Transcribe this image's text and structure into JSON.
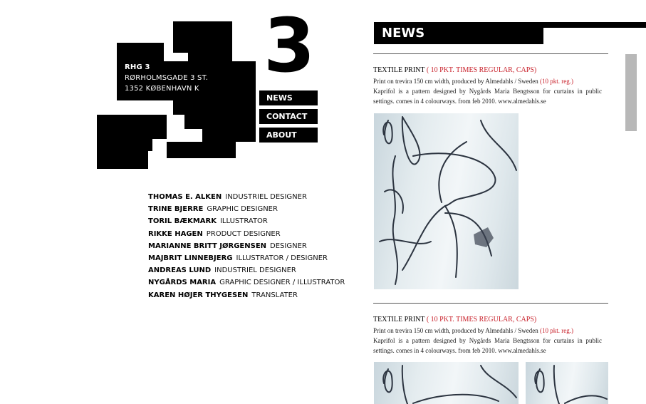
{
  "logo": {
    "number": "3",
    "name": "RHG 3",
    "address_line1": "RØRHOLMSGADE 3 ST.",
    "address_line2": "1352 KØBENHAVN K"
  },
  "nav": {
    "items": [
      {
        "label": "NEWS"
      },
      {
        "label": "CONTACT"
      },
      {
        "label": "ABOUT"
      }
    ]
  },
  "people": [
    {
      "name": "THOMAS E. ALKEN",
      "role": "INDUSTRIEL DESIGNER"
    },
    {
      "name": "TRINE BJERRE",
      "role": "GRAPHIC DESIGNER"
    },
    {
      "name": "TORIL BÆKMARK",
      "role": "ILLUSTRATOR"
    },
    {
      "name": "RIKKE HAGEN",
      "role": "PRODUCT DESIGNER"
    },
    {
      "name": "MARIANNE BRITT JØRGENSEN",
      "role": "DESIGNER"
    },
    {
      "name": "MAJBRIT LINNEBJERG",
      "role": "ILLUSTRATOR / DESIGNER"
    },
    {
      "name": "ANDREAS LUND",
      "role": "INDUSTRIEL DESIGNER"
    },
    {
      "name": "NYGÅRDS MARIA",
      "role": "GRAPHIC DESIGNER / ILLUSTRATOR"
    },
    {
      "name": "KAREN HØJER THYGESEN",
      "role": "TRANSLATER"
    }
  ],
  "news": {
    "heading": "NEWS",
    "articles": [
      {
        "title": "TEXTILE PRINT",
        "title_note": "( 10 PKT. TIMES REGULAR, CAPS)",
        "line1": "Print on trevira 150 cm width, produced by Almedahls / Sweden",
        "line1_note": "(10 pkt. reg.)",
        "body": "Kaprifol is a pattern designed by Nygårds Maria Bengtsson for curtains in public settings. comes in 4 colourways. from feb 2010. www.almedahls.se"
      },
      {
        "title": "TEXTILE PRINT",
        "title_note": "( 10 PKT. TIMES REGULAR, CAPS)",
        "line1": "Print on trevira 150 cm width, produced by Almedahls / Sweden",
        "line1_note": "(10 pkt. reg.)",
        "body": "Kaprifol is a pattern designed by Nygårds Maria Bengtsson for curtains in public settings. comes in 4 colourways. from feb 2010. www.almedahls.se"
      }
    ]
  },
  "colors": {
    "accent_red": "#c8202a",
    "black": "#000000",
    "scrollbar": "#b8b8b8"
  }
}
